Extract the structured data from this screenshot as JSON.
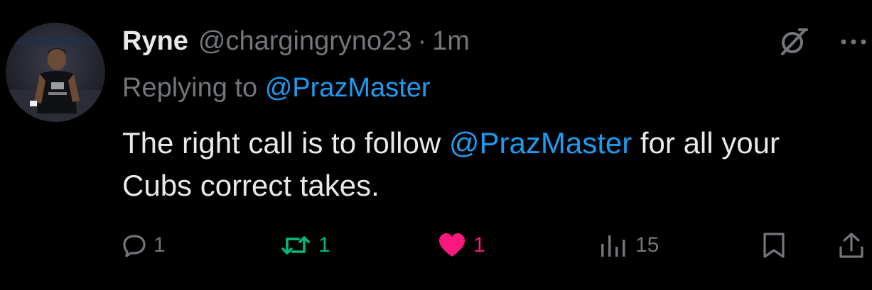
{
  "author": {
    "name": "Ryne",
    "handle": "@chargingryno23",
    "separator": "·",
    "time": "1m",
    "avatar_icon": "avatar-photo-icon"
  },
  "reply_context": {
    "prefix": "Replying to",
    "mention": "@PrazMaster"
  },
  "tweet": {
    "text_part1": "The right call is to follow",
    "mention": "@PrazMaster",
    "text_part2": "for all your",
    "text_line2": "Cubs correct takes."
  },
  "top_icons": {
    "grok_icon": "grok-icon",
    "more_icon": "more-icon"
  },
  "actions": {
    "reply_count": "1",
    "retweet_count": "1",
    "like_count": "1",
    "views_count": "15"
  },
  "colors": {
    "background": "#000000",
    "text": "#e7e9ea",
    "muted": "#71767b",
    "link": "#1d9bf0",
    "retweet_active": "#00ba7c",
    "like_active": "#f91880"
  }
}
